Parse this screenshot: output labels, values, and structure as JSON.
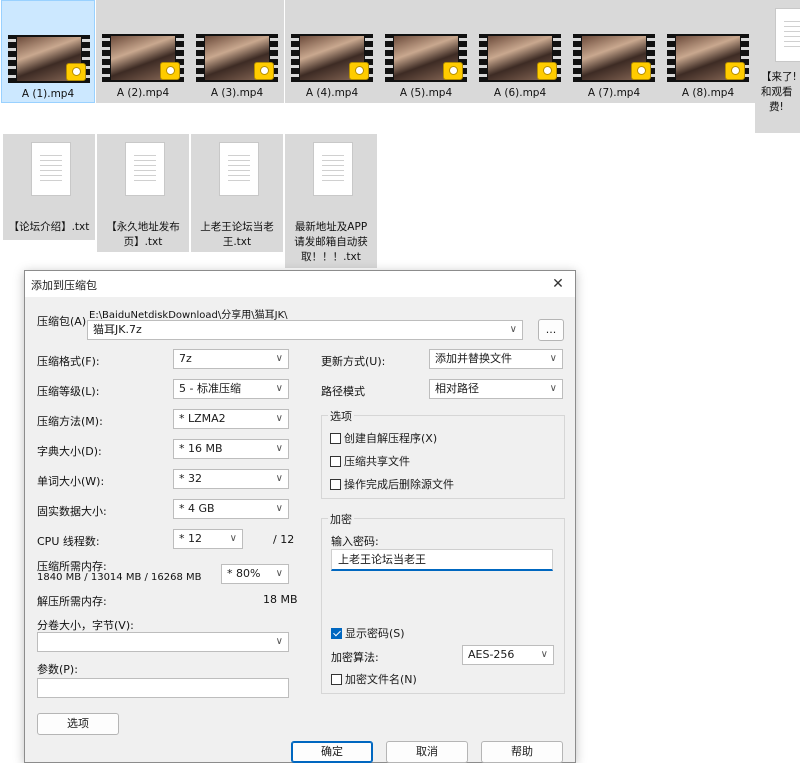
{
  "files_row1": [
    {
      "name": "A (1).mp4",
      "selected": true
    },
    {
      "name": "A (2).mp4",
      "selected": false
    },
    {
      "name": "A (3).mp4",
      "selected": false
    },
    {
      "name": "A (4).mp4",
      "selected": false
    },
    {
      "name": "A (5).mp4",
      "selected": false
    },
    {
      "name": "A (6).mp4",
      "selected": false
    },
    {
      "name": "A (7).mp4",
      "selected": false
    },
    {
      "name": "A (8).mp4",
      "selected": false
    }
  ],
  "partial_file_text": [
    "【来了!",
    "和观看",
    "费!"
  ],
  "files_row2": [
    {
      "lines": [
        "【论坛介绍】.txt"
      ]
    },
    {
      "lines": [
        "【永久地址发布",
        "页】.txt"
      ]
    },
    {
      "lines": [
        "上老王论坛当老",
        "王.txt"
      ]
    },
    {
      "lines": [
        "最新地址及APP",
        "请发邮箱自动获",
        "取！！！.txt"
      ]
    }
  ],
  "dialog": {
    "title": "添加到压缩包",
    "archive_label": "压缩包(A)",
    "archive_path": "E:\\BaiduNetdiskDownload\\分享用\\猫耳JK\\",
    "archive_name": "猫耳JK.7z",
    "browse_label": "...",
    "left": {
      "format_label": "压缩格式(F):",
      "format_value": "7z",
      "level_label": "压缩等级(L):",
      "level_value": "5 - 标准压缩",
      "method_label": "压缩方法(M):",
      "method_value": "* LZMA2",
      "dict_label": "字典大小(D):",
      "dict_value": "* 16 MB",
      "word_label": "单词大小(W):",
      "word_value": "* 32",
      "solid_label": "固实数据大小:",
      "solid_value": "* 4 GB",
      "cpu_label": "CPU 线程数:",
      "cpu_value": "* 12",
      "cpu_total": "/ 12",
      "mem_label": "压缩所需内存:",
      "mem_detail": "1840 MB / 13014 MB / 16268 MB",
      "mem_value": "* 80%",
      "decomp_label": "解压所需内存:",
      "decomp_value": "18 MB",
      "split_label": "分卷大小，字节(V):",
      "split_value": "",
      "params_label": "参数(P):",
      "params_value": "",
      "options_button": "选项"
    },
    "right": {
      "update_label": "更新方式(U):",
      "update_value": "添加并替换文件",
      "path_label": "路径模式",
      "path_value": "相对路径",
      "options_group": "选项",
      "opt_sfx": "创建自解压程序(X)",
      "opt_sfx_checked": false,
      "opt_shared": "压缩共享文件",
      "opt_shared_checked": false,
      "opt_delete": "操作完成后删除源文件",
      "opt_delete_checked": false,
      "encrypt_group": "加密",
      "password_label": "输入密码:",
      "password_value": "上老王论坛当老王",
      "show_password": "显示密码(S)",
      "show_password_checked": true,
      "enc_method_label": "加密算法:",
      "enc_method_value": "AES-256",
      "enc_names": "加密文件名(N)",
      "enc_names_checked": false
    },
    "buttons": {
      "ok": "确定",
      "cancel": "取消",
      "help": "帮助"
    }
  },
  "colors": {
    "accent": "#0067c0",
    "selected_tile": "#cce8ff",
    "tile_bg": "#d9d9d9"
  }
}
